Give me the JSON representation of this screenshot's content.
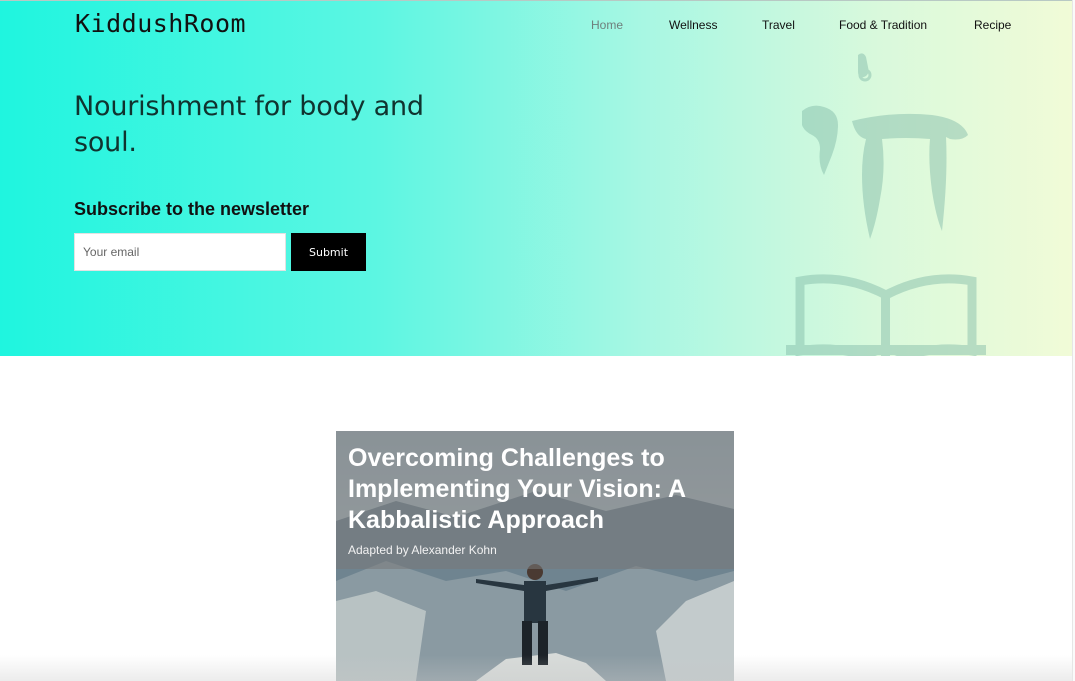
{
  "brand": {
    "logo_text": "KiddushRoom"
  },
  "nav": {
    "items": [
      {
        "label": "Home",
        "active": true
      },
      {
        "label": "Wellness",
        "active": false
      },
      {
        "label": "Travel",
        "active": false
      },
      {
        "label": "Food & Tradition",
        "active": false
      },
      {
        "label": "Recipe",
        "active": false
      }
    ]
  },
  "hero": {
    "headline": "Nourishment for body and soul.",
    "newsletter_title": "Subscribe to the newsletter",
    "email_placeholder": "Your email",
    "email_value": "",
    "submit_label": "Submit",
    "colors": {
      "gradient_start": "#1ff5df",
      "gradient_end": "#f1fbd7",
      "button": "#000000"
    },
    "art_icon": "hebrew-letters-book-icon"
  },
  "article": {
    "title": "Overcoming Challenges to Implementing Your Vision: A Kabbalistic Approach",
    "author": "Adapted by Alexander Kohn",
    "image_icon": "mountain-man-photo"
  }
}
